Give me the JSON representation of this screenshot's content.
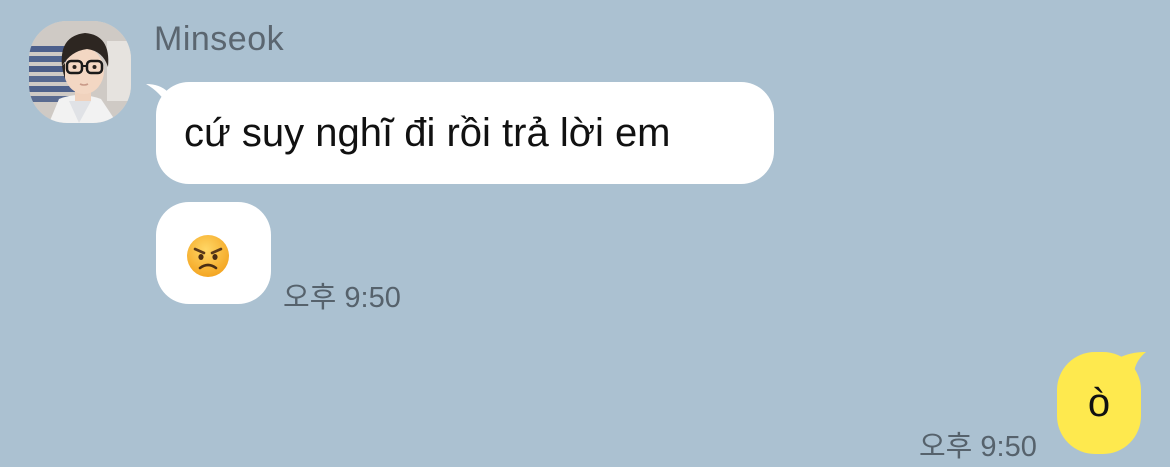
{
  "colors": {
    "background": "#abc1d1",
    "incoming_bubble": "#ffffff",
    "outgoing_bubble": "#fee94e",
    "meta_text": "#56626c"
  },
  "sender": {
    "name": "Minseok"
  },
  "messages": {
    "incoming_text": "cứ suy nghĩ đi rồi trả lời em",
    "incoming_emoji": "angry-face-emoji",
    "incoming_time": "오후 9:50",
    "outgoing_text": "ò",
    "outgoing_time": "오후 9:50"
  }
}
